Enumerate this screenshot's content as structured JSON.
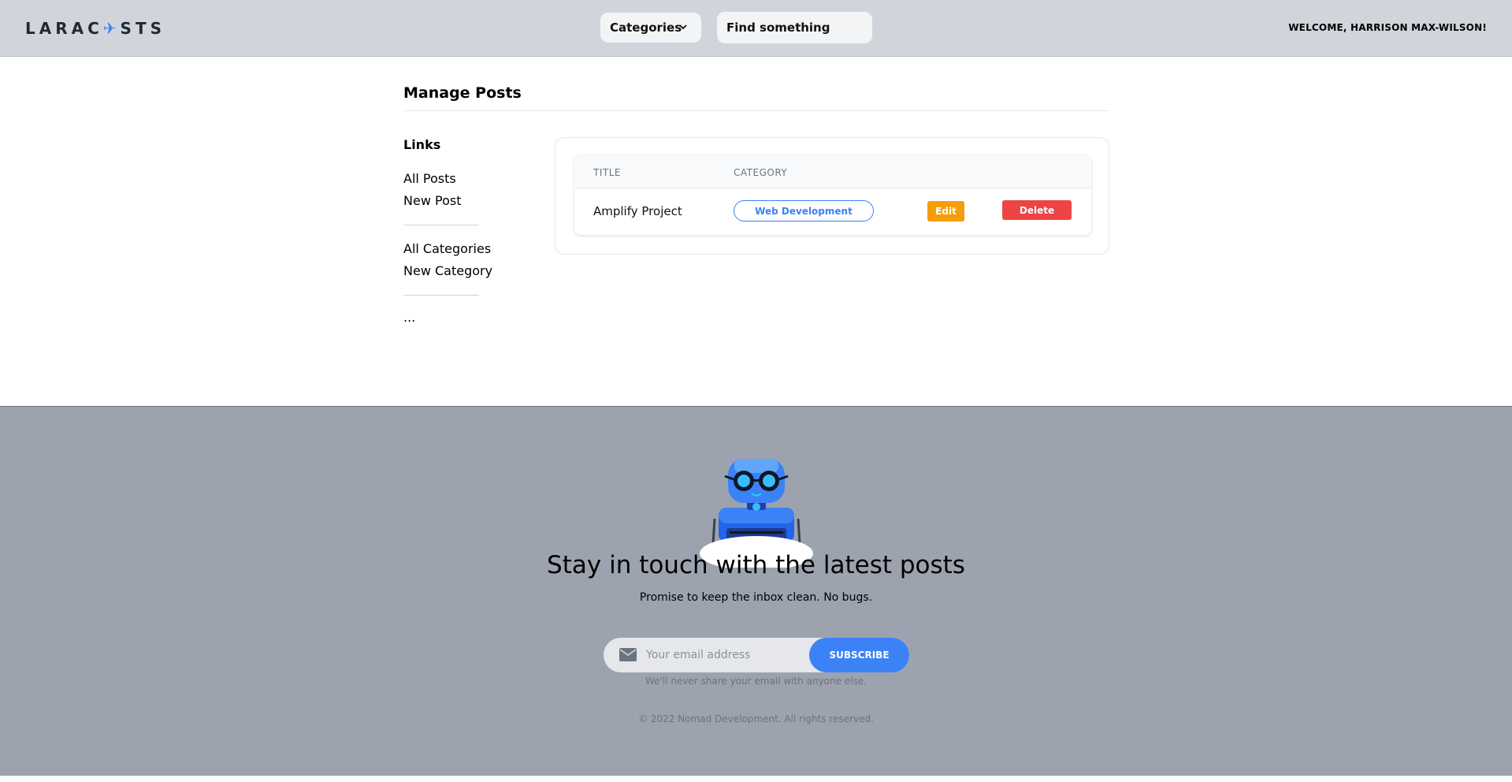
{
  "header": {
    "logo_text_left": "LARAC",
    "logo_text_right": "STS",
    "categories_label": "Categories",
    "search_placeholder": "Find something",
    "welcome": "Welcome, Harrison Max-Wilson!"
  },
  "main": {
    "title": "Manage Posts",
    "sidebar": {
      "heading": "Links",
      "items": [
        {
          "label": "All Posts"
        },
        {
          "label": "New Post"
        },
        {
          "label": "All Categories"
        },
        {
          "label": "New Category"
        },
        {
          "label": "..."
        }
      ]
    },
    "table": {
      "columns": [
        "Title",
        "Category"
      ],
      "rows": [
        {
          "title": "Amplify Project",
          "category": "Web Development",
          "edit": "Edit",
          "delete": "Delete"
        }
      ]
    }
  },
  "footer": {
    "heading": "Stay in touch with the latest posts",
    "subheading": "Promise to keep the inbox clean. No bugs.",
    "email_placeholder": "Your email address",
    "subscribe_label": "Subscribe",
    "privacy": "We'll never share your email with anyone else.",
    "copyright": "© 2022 Nomad Development. All rights reserved."
  },
  "colors": {
    "header_bg": "#d1d5db",
    "footer_bg": "#9ca3af",
    "accent": "#3b82f6",
    "edit": "#f59e0b",
    "delete": "#ef4444"
  },
  "icons": [
    "logo-icon",
    "chevron-down-icon",
    "mail-icon",
    "robot-illustration"
  ]
}
